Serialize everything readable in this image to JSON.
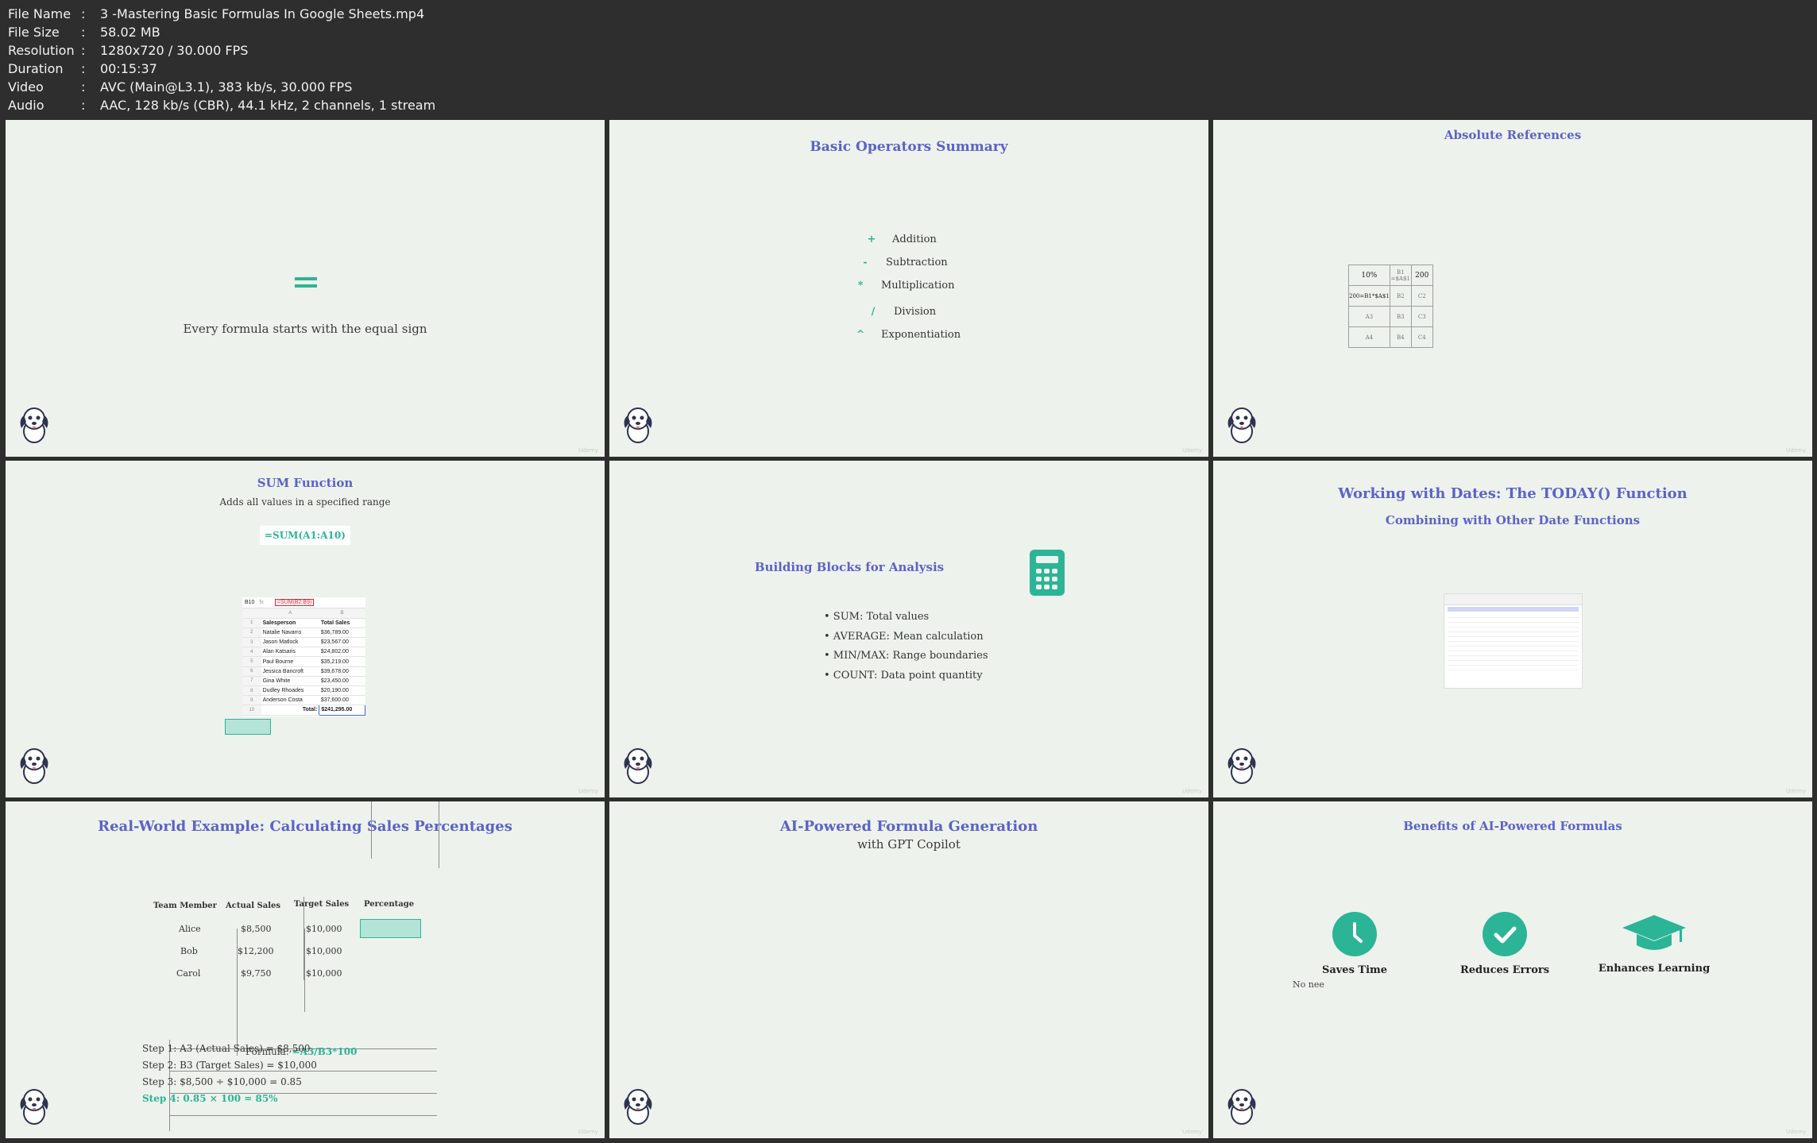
{
  "meta": {
    "rows": [
      {
        "key": "File Name",
        "value": "3 -Mastering Basic Formulas In Google Sheets.mp4"
      },
      {
        "key": "File Size",
        "value": "58.02 MB"
      },
      {
        "key": "Resolution",
        "value": "1280x720 / 30.000 FPS"
      },
      {
        "key": "Duration",
        "value": "00:15:37"
      },
      {
        "key": "Video",
        "value": "AVC (Main@L3.1), 383 kb/s, 30.000 FPS"
      },
      {
        "key": "Audio",
        "value": "AAC, 128 kb/s (CBR), 44.1 kHz, 2 channels, 1 stream"
      }
    ]
  },
  "watermark": "Udemy",
  "colors": {
    "accent": "#2bb596",
    "title": "#5b63c9",
    "background": "#eef2ec"
  },
  "tile1": {
    "caption": "Every formula starts with the equal sign"
  },
  "tile2": {
    "title": "Basic Operators Summary",
    "operators": [
      {
        "symbol": "+",
        "label": "Addition"
      },
      {
        "symbol": "-",
        "label": "Subtraction"
      },
      {
        "symbol": "*",
        "label": "Multiplication"
      },
      {
        "symbol": "/",
        "label": "Division"
      },
      {
        "symbol": "^",
        "label": "Exponentiation"
      }
    ]
  },
  "tile3": {
    "title": "Absolute References",
    "grid": [
      [
        "10%",
        "B1 =$A$1",
        "200"
      ],
      [
        "200=B1*$A$1",
        "B2",
        "C2"
      ],
      [
        "A3",
        "B3",
        "C3"
      ],
      [
        "A4",
        "B4",
        "C4"
      ]
    ]
  },
  "tile4": {
    "title": "SUM Function",
    "subtitle": "Adds all values in a specified range",
    "formula": "=SUM(A1:A10)",
    "sheet": {
      "cell_ref": "B10",
      "fx": "fx",
      "bar_formula": "=SUM(B2:B9)",
      "columns": [
        "A",
        "B"
      ],
      "headers": [
        "Salesperson",
        "Total Sales"
      ],
      "rows": [
        [
          "Natalie Navarro",
          "$36,789.00"
        ],
        [
          "Jason Matlock",
          "$23,567.00"
        ],
        [
          "Alan Katsaris",
          "$24,802.00"
        ],
        [
          "Paul Bourne",
          "$35,219.00"
        ],
        [
          "Jessica Bancroft",
          "$39,678.00"
        ],
        [
          "Gina White",
          "$23,450.00"
        ],
        [
          "Dudley Rhoades",
          "$20,190.00"
        ],
        [
          "Anderson Costa",
          "$37,600.00"
        ]
      ],
      "total_label": "Total:",
      "total_value": "$241,295.00"
    }
  },
  "tile5": {
    "title": "Building Blocks for Analysis",
    "bullets": [
      "• SUM: Total values",
      "• AVERAGE: Mean calculation",
      "• MIN/MAX: Range boundaries",
      "• COUNT: Data point quantity"
    ]
  },
  "tile6": {
    "title": "Working with Dates: The TODAY() Function",
    "subtitle": "Combining with Other Date Functions"
  },
  "tile7": {
    "title": "Real-World Example: Calculating Sales Percentages",
    "headers": [
      "Team Member",
      "Actual Sales",
      "Target Sales",
      "Percentage"
    ],
    "rows": [
      [
        "Alice",
        "$8,500",
        "$10,000"
      ],
      [
        "Bob",
        "$12,200",
        "$10,000"
      ],
      [
        "Carol",
        "$9,750",
        "$10,000"
      ]
    ],
    "formula_label": "Formula: ",
    "formula_value": "=A3/B3*100",
    "steps": [
      "Step 1: A3 (Actual Sales) = $8,500",
      "Step 2: B3 (Target Sales) = $10,000",
      "Step 3: $8,500 ÷ $10,000 = 0.85",
      "Step 4: 0.85 × 100 = 85%"
    ]
  },
  "tile8": {
    "title": "AI-Powered Formula Generation",
    "subtitle": "with GPT Copilot"
  },
  "tile9": {
    "title": "Benefits of AI-Powered Formulas",
    "benefits": [
      "Saves Time",
      "Reduces Errors",
      "Enhances Learning"
    ],
    "faint": "No nee"
  }
}
